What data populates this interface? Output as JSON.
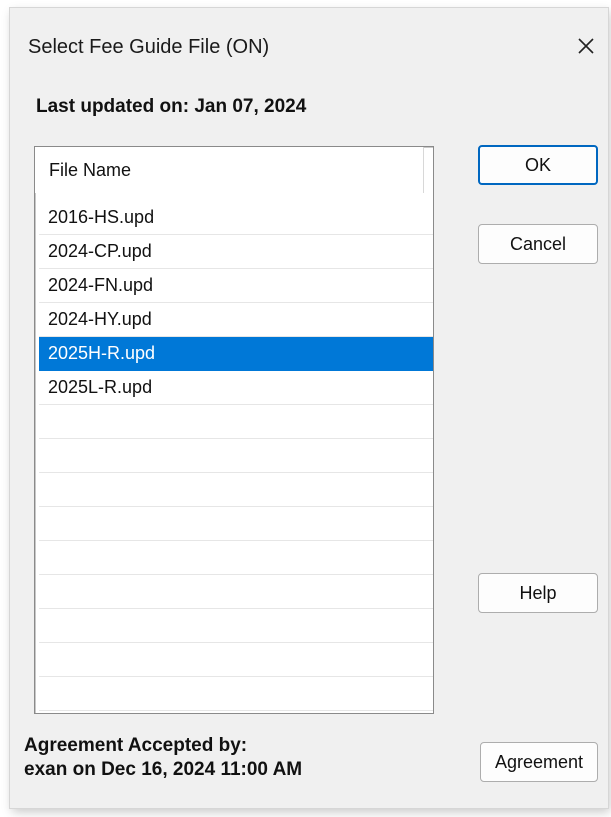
{
  "window": {
    "title": "Select Fee Guide File (ON)"
  },
  "last_updated": "Last updated on: Jan 07, 2024",
  "file_list": {
    "column_header": "File Name",
    "items": [
      {
        "name": "2016-HS.upd",
        "selected": false
      },
      {
        "name": "2024-CP.upd",
        "selected": false
      },
      {
        "name": "2024-FN.upd",
        "selected": false
      },
      {
        "name": "2024-HY.upd",
        "selected": false
      },
      {
        "name": "2025H-R.upd",
        "selected": true
      },
      {
        "name": "2025L-R.upd",
        "selected": false
      }
    ],
    "empty_rows": 9
  },
  "buttons": {
    "ok": "OK",
    "cancel": "Cancel",
    "help": "Help",
    "agreement": "Agreement"
  },
  "agreement_info": {
    "line1": "Agreement Accepted by:",
    "line2": "exan on Dec 16, 2024 11:00 AM"
  },
  "icons": {
    "close": "close-icon"
  },
  "colors": {
    "selection": "#0078d7",
    "dialog_bg": "#f0f0f0",
    "default_button_border": "#0067c0"
  }
}
